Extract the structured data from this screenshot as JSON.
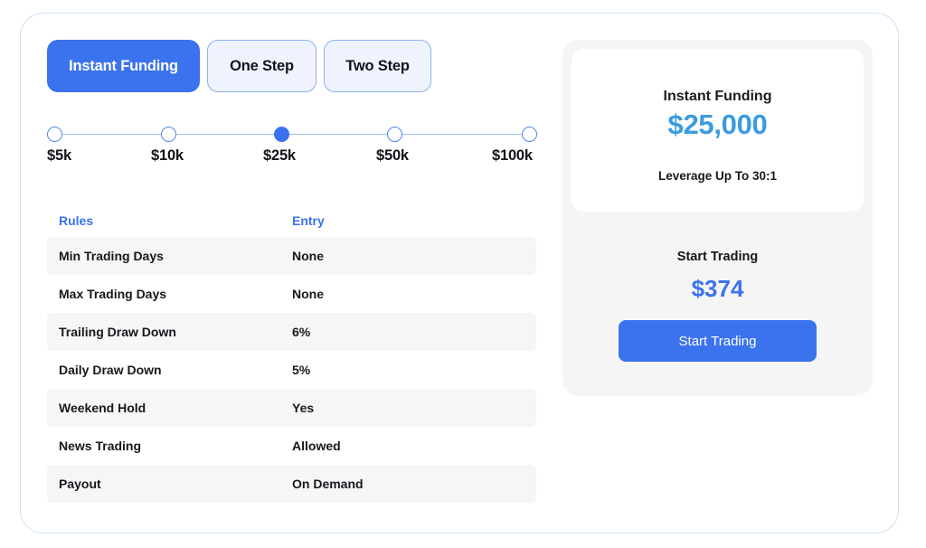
{
  "tabs": [
    {
      "label": "Instant Funding",
      "active": true
    },
    {
      "label": "One Step",
      "active": false
    },
    {
      "label": "Two Step",
      "active": false
    }
  ],
  "slider": {
    "stops": [
      "$5k",
      "$10k",
      "$25k",
      "$50k",
      "$100k"
    ],
    "selected_index": 2
  },
  "rules": {
    "header": {
      "rule": "Rules",
      "entry": "Entry"
    },
    "rows": [
      {
        "rule": "Min Trading Days",
        "entry": "None"
      },
      {
        "rule": "Max Trading Days",
        "entry": "None"
      },
      {
        "rule": "Trailing Draw Down",
        "entry": "6%"
      },
      {
        "rule": "Daily Draw Down",
        "entry": "5%"
      },
      {
        "rule": "Weekend Hold",
        "entry": "Yes"
      },
      {
        "rule": "News Trading",
        "entry": "Allowed"
      },
      {
        "rule": "Payout",
        "entry": "On Demand"
      }
    ]
  },
  "summary": {
    "title": "Instant Funding",
    "amount": "$25,000",
    "leverage": "Leverage  Up To 30:1",
    "start_label": "Start Trading",
    "price": "$374",
    "button_label": "Start Trading"
  },
  "colors": {
    "accent": "#3b73ee",
    "amount": "#3b9bdf",
    "card_border": "#cfe0f6",
    "row_shade": "#f6f6f7",
    "panel_bg": "#f5f5f6"
  }
}
